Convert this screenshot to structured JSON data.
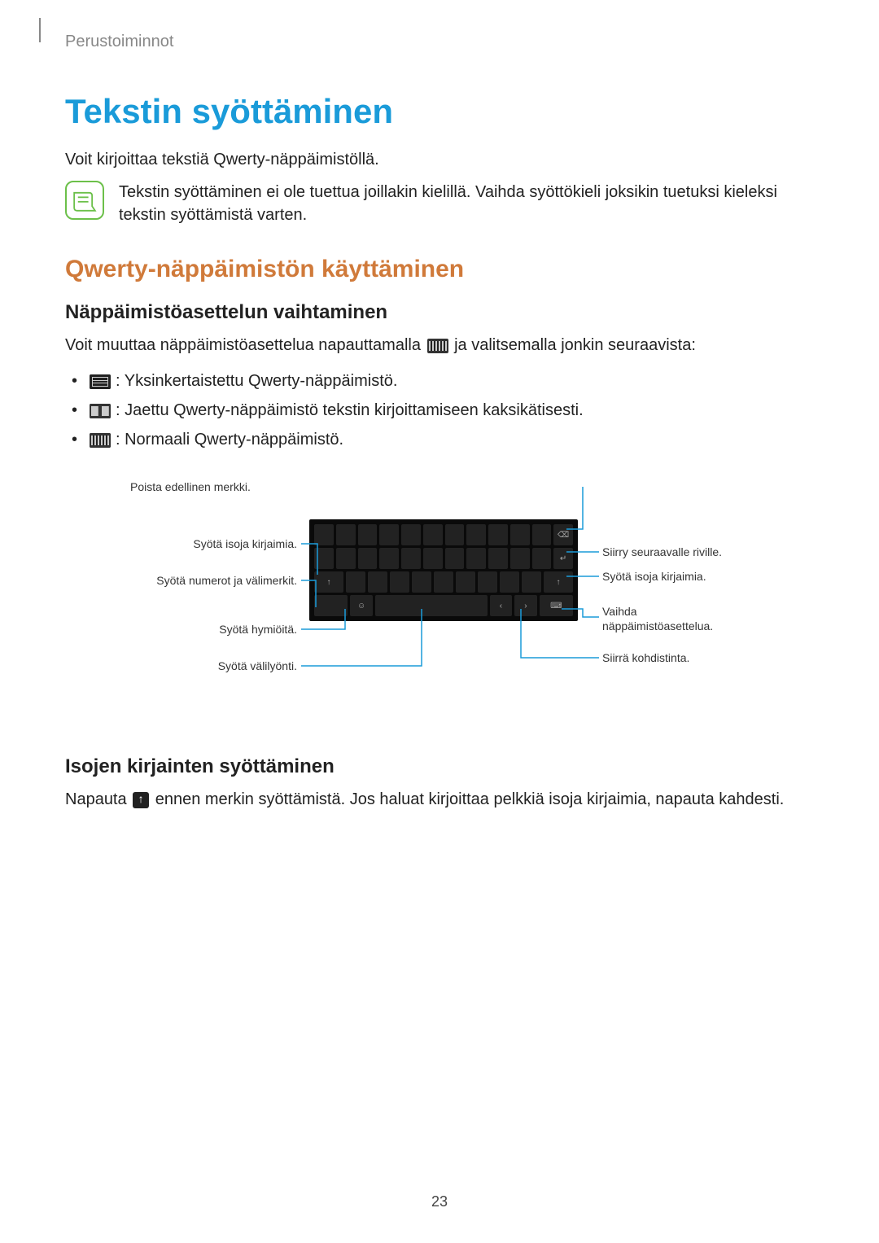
{
  "breadcrumb": "Perustoiminnot",
  "title": "Tekstin syöttäminen",
  "intro": "Voit kirjoittaa tekstiä Qwerty-näppäimistöllä.",
  "note": "Tekstin syöttäminen ei ole tuettua joillakin kielillä. Vaihda syöttökieli joksikin tuetuksi kieleksi tekstin syöttämistä varten.",
  "section": {
    "heading": "Qwerty-näppäimistön käyttäminen",
    "sub1": {
      "heading": "Näppäimistöasettelun vaihtaminen",
      "para_pre": "Voit muuttaa näppäimistöasettelua napauttamalla ",
      "para_post": " ja valitsemalla jonkin seuraavista:",
      "items": [
        ": Yksinkertaistettu Qwerty-näppäimistö.",
        ": Jaettu Qwerty-näppäimistö tekstin kirjoittamiseen kaksikätisesti.",
        ": Normaali Qwerty-näppäimistö."
      ]
    },
    "diagram": {
      "left": [
        "Syötä isoja kirjaimia.",
        "Syötä numerot ja välimerkit.",
        "Syötä hymiöitä.",
        "Syötä välilyönti."
      ],
      "right": [
        "Poista edellinen merkki.",
        "Siirry seuraavalle riville.",
        "Syötä isoja kirjaimia.",
        "Vaihda näppäimistöasettelua.",
        "Siirrä kohdistinta."
      ]
    },
    "sub2": {
      "heading": "Isojen kirjainten syöttäminen",
      "para_pre": "Napauta ",
      "para_post": " ennen merkin syöttämistä. Jos haluat kirjoittaa pelkkiä isoja kirjaimia, napauta kahdesti."
    }
  },
  "page_number": "23"
}
